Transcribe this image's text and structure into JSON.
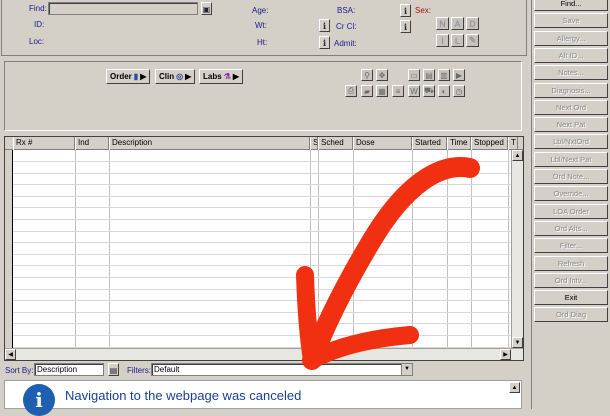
{
  "patient": {
    "find_label": "Find:",
    "id_label": "ID:",
    "loc_label": "Loc:",
    "age_label": "Age:",
    "wt_label": "Wt:",
    "ht_label": "Ht:",
    "bsa_label": "BSA:",
    "crcl_label": "Cr Cl:",
    "admit_label": "Admit:",
    "sex_label": "Sex:",
    "info_glyph": "i",
    "sex_buttons": [
      "N",
      "A",
      "D",
      "I",
      "L"
    ]
  },
  "order_toolbar": {
    "order_label": "Order",
    "clin_label": "Clin",
    "labs_label": "Labs"
  },
  "grid": {
    "columns": [
      "Rx #",
      "Ind",
      "Description",
      "S",
      "Sched",
      "Dose",
      "Started",
      "Time",
      "Stopped",
      "T"
    ]
  },
  "sort_bar": {
    "sort_by_label": "Sort By:",
    "sort_by_value": "Description",
    "filters_label": "Filters:",
    "filters_value": "Default"
  },
  "notice": {
    "icon_glyph": "i",
    "message": "Navigation to the webpage was canceled"
  },
  "side_buttons": [
    {
      "label": "Find...",
      "enabled": true
    },
    {
      "label": "Save",
      "enabled": false
    },
    {
      "label": "Allergy...",
      "enabled": false
    },
    {
      "label": "Alt ID...",
      "enabled": false
    },
    {
      "label": "Notes...",
      "enabled": false
    },
    {
      "label": "Diagnosis...",
      "enabled": false
    },
    {
      "label": "Next Ord",
      "enabled": false
    },
    {
      "label": "Next Pat",
      "enabled": false
    },
    {
      "label": "Lbl/NxtOrd",
      "enabled": false
    },
    {
      "label": "Lbl/Next Pat",
      "enabled": false
    },
    {
      "label": "Ord Note...",
      "enabled": false
    },
    {
      "label": "Override...",
      "enabled": false
    },
    {
      "label": "LOA Order",
      "enabled": false
    },
    {
      "label": "Ord Alts...",
      "enabled": false
    },
    {
      "label": "Filter...",
      "enabled": false
    },
    {
      "label": "Refresh",
      "enabled": false
    },
    {
      "label": "Ord Intv...",
      "enabled": false
    },
    {
      "label": "Exit",
      "enabled": true
    },
    {
      "label": "Ord Diag",
      "enabled": false
    }
  ],
  "colors": {
    "annotation_arrow": "#f03010",
    "label_blue": "#1a1a8a",
    "notice_text": "#1c3f94"
  }
}
